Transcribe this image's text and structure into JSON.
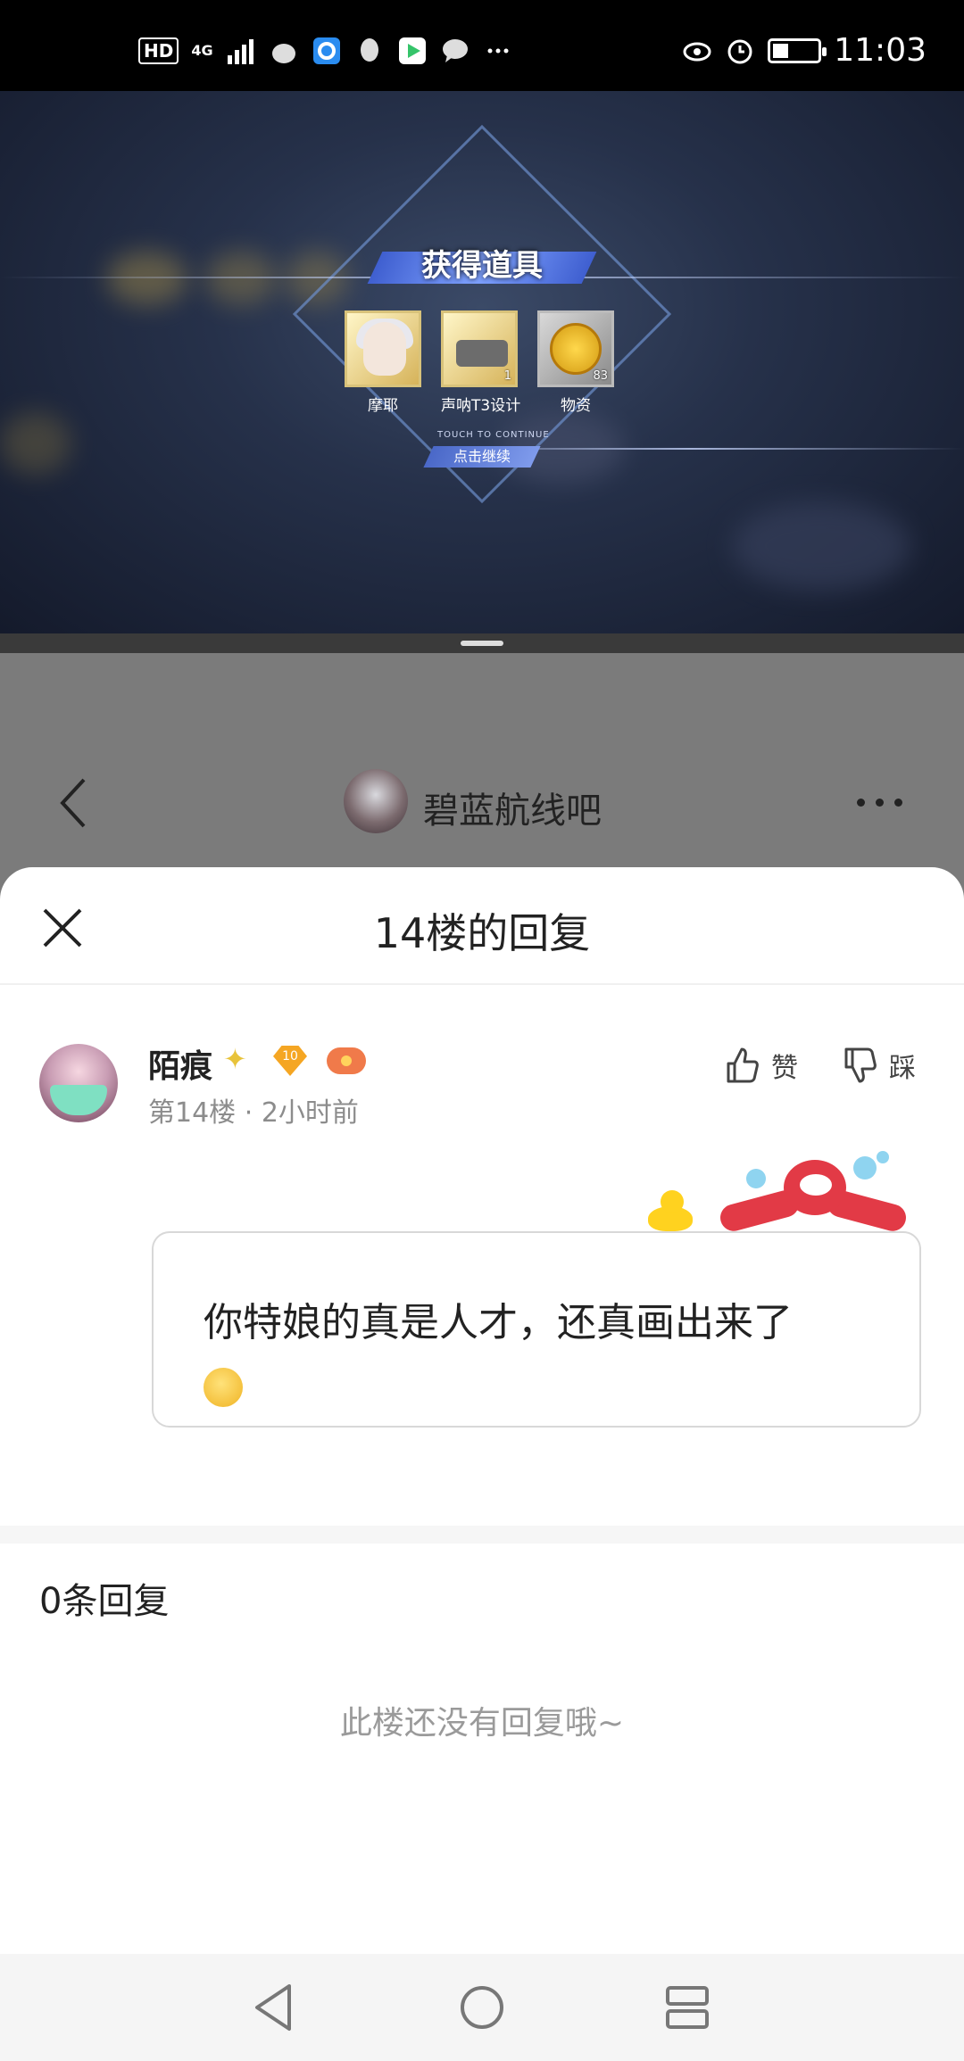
{
  "status_bar": {
    "hd": "HD",
    "network": "4G",
    "time": "11:03",
    "battery_level": 0.35
  },
  "game": {
    "banner_title": "获得道具",
    "items": [
      {
        "label": "摩耶",
        "count": ""
      },
      {
        "label": "声呐T3设计",
        "count": "1"
      },
      {
        "label": "物资",
        "count": "83"
      }
    ],
    "touch_hint": "TOUCH TO CONTINUE",
    "continue_label": "点击继续"
  },
  "app_header": {
    "forum_name": "碧蓝航线吧"
  },
  "sheet": {
    "title": "14楼的回复",
    "post": {
      "username": "陌痕",
      "level_badge": "10",
      "floor": "第14楼",
      "time_ago": "2小时前",
      "like_label": "赞",
      "dislike_label": "踩",
      "content": "你特娘的真是人才，还真画出来了"
    },
    "reply_count_label": "0条回复",
    "empty_message": "此楼还没有回复哦~"
  },
  "colors": {
    "sheet_bg": "#ffffff",
    "dim_overlay": "#7b7b7b",
    "meta_text": "#8c8c8c"
  }
}
